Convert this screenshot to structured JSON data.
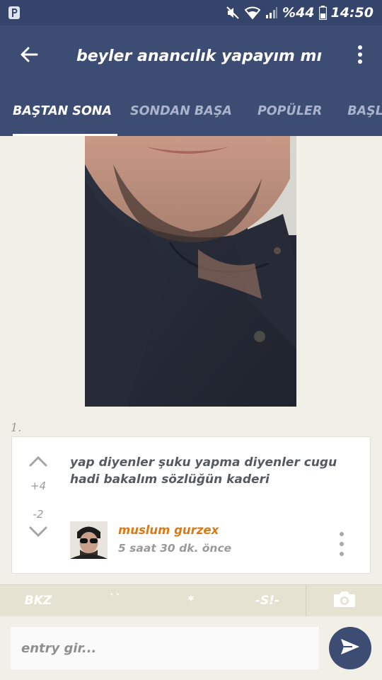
{
  "status_bar": {
    "battery": "%44",
    "time": "14:50"
  },
  "header": {
    "title": "beyler anancılık yapayım mı"
  },
  "tabs": [
    {
      "label": "BAŞTAN SONA",
      "active": true
    },
    {
      "label": "SONDAN BAŞA",
      "active": false
    },
    {
      "label": "POPÜLER",
      "active": false
    },
    {
      "label": "BAŞLIK",
      "active": false
    }
  ],
  "entry": {
    "index": "1.",
    "text": "yap diyenler şuku yapma diyenler cugu hadi bakalım sözlüğün kaderi",
    "upvotes": "+4",
    "downvotes": "-2",
    "author": "muslum gurzex",
    "timestamp": "5 saat 30 dk. önce"
  },
  "format_bar": {
    "bkz": "BKZ",
    "hede": "``",
    "star": "*",
    "spoiler": "-S!-"
  },
  "composer": {
    "placeholder": "entry gir..."
  },
  "colors": {
    "primary": "#3d4c72",
    "status_bar": "#34446a",
    "background": "#f2f0e6",
    "author": "#d97a14",
    "format_bar": "#e6e2d2"
  }
}
